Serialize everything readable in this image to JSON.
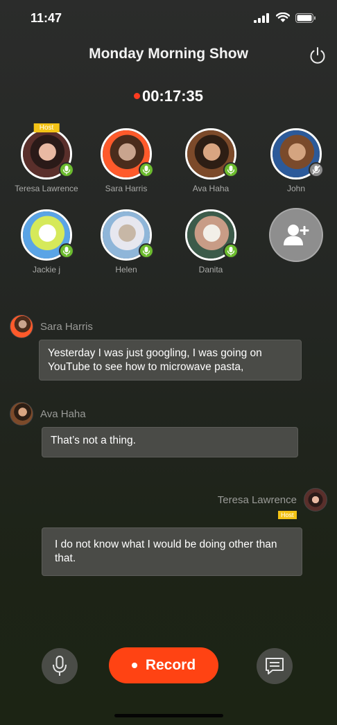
{
  "status_bar": {
    "time": "11:47"
  },
  "header": {
    "title": "Monday Morning Show"
  },
  "timer": {
    "elapsed": "00:17:35"
  },
  "host_label": "Host",
  "participants": [
    {
      "name": "Teresa Lawrence",
      "host": true,
      "mic": "on",
      "colors": [
        "#5a2f2b",
        "#2a1a18",
        "#e9b9a3"
      ]
    },
    {
      "name": "Sara Harris",
      "host": false,
      "mic": "on",
      "colors": [
        "#ff5a2b",
        "#4a2c1c",
        "#c9a48e"
      ]
    },
    {
      "name": "Ava Haha",
      "host": false,
      "mic": "on",
      "colors": [
        "#7c4a2a",
        "#2d1e14",
        "#d9a581"
      ]
    },
    {
      "name": "John",
      "host": false,
      "mic": "muted",
      "colors": [
        "#2c5a9a",
        "#7a4a2b",
        "#d4a480"
      ]
    },
    {
      "name": "Jackie j",
      "host": false,
      "mic": "on",
      "colors": [
        "#5aa4e6",
        "#d6e95a",
        "#ffffff"
      ]
    },
    {
      "name": "Helen",
      "host": false,
      "mic": "on",
      "colors": [
        "#8fb6d9",
        "#e7e7ef",
        "#c7b7a6"
      ]
    },
    {
      "name": "Danita",
      "host": false,
      "mic": "on",
      "colors": [
        "#3c5b4a",
        "#c89c86",
        "#f2efe8"
      ]
    }
  ],
  "messages": [
    {
      "sender": "Sara Harris",
      "text": "Yesterday I was just googling, I was going on YouTube to see how to microwave pasta,",
      "align": "left",
      "host": false
    },
    {
      "sender": "Ava Haha",
      "text": "That’s not a thing.",
      "align": "left",
      "host": false
    },
    {
      "sender": "Teresa Lawrence",
      "text": "I do not know what I would be doing other than that.",
      "align": "right",
      "host": true
    }
  ],
  "controls": {
    "record_label": "Record",
    "mic_icon": "microphone-icon",
    "chat_icon": "chat-icon"
  },
  "colors": {
    "accent": "#ff4313",
    "mic_on": "#6cbb2e",
    "host_badge": "#f3c316",
    "recording_dot": "#ff3b1f"
  }
}
